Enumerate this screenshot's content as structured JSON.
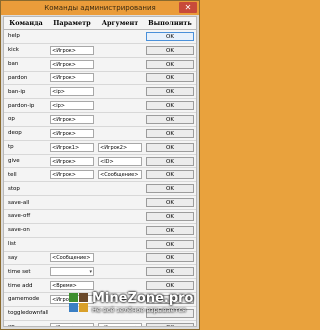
{
  "window": {
    "title": "Команды администрирования",
    "close_glyph": "✕"
  },
  "headers": [
    "Команда",
    "Параметр",
    "Аргумент",
    "Выполнить"
  ],
  "rows": [
    {
      "cmd": "help",
      "param": null,
      "arg": null,
      "ok": "OK",
      "primary": true
    },
    {
      "cmd": "kick",
      "param": {
        "type": "text",
        "value": "<Игрок>"
      },
      "arg": null,
      "ok": "OK"
    },
    {
      "cmd": "ban",
      "param": {
        "type": "text",
        "value": "<Игрок>"
      },
      "arg": null,
      "ok": "OK"
    },
    {
      "cmd": "pardon",
      "param": {
        "type": "text",
        "value": "<Игрок>"
      },
      "arg": null,
      "ok": "OK"
    },
    {
      "cmd": "ban-ip",
      "param": {
        "type": "text",
        "value": "<ip>"
      },
      "arg": null,
      "ok": "OK"
    },
    {
      "cmd": "pardon-ip",
      "param": {
        "type": "text",
        "value": "<ip>"
      },
      "arg": null,
      "ok": "OK"
    },
    {
      "cmd": "op",
      "param": {
        "type": "text",
        "value": "<Игрок>"
      },
      "arg": null,
      "ok": "OK"
    },
    {
      "cmd": "deop",
      "param": {
        "type": "text",
        "value": "<Игрок>"
      },
      "arg": null,
      "ok": "OK"
    },
    {
      "cmd": "tp",
      "param": {
        "type": "text",
        "value": "<Игрок1>"
      },
      "arg": {
        "type": "text",
        "value": "<Игрок2>"
      },
      "ok": "OK"
    },
    {
      "cmd": "give",
      "param": {
        "type": "text",
        "value": "<Игрок>"
      },
      "arg": {
        "type": "text",
        "value": "<ID>"
      },
      "ok": "OK"
    },
    {
      "cmd": "tell",
      "param": {
        "type": "text",
        "value": "<Игрок>"
      },
      "arg": {
        "type": "text",
        "value": "<Сообщение>"
      },
      "ok": "OK"
    },
    {
      "cmd": "stop",
      "param": null,
      "arg": null,
      "ok": "OK"
    },
    {
      "cmd": "save-all",
      "param": null,
      "arg": null,
      "ok": "OK"
    },
    {
      "cmd": "save-off",
      "param": null,
      "arg": null,
      "ok": "OK"
    },
    {
      "cmd": "save-on",
      "param": null,
      "arg": null,
      "ok": "OK"
    },
    {
      "cmd": "list",
      "param": null,
      "arg": null,
      "ok": "OK"
    },
    {
      "cmd": "say",
      "param": {
        "type": "text",
        "value": "<Сообщение>"
      },
      "arg": null,
      "ok": "OK"
    },
    {
      "cmd": "time set",
      "param": {
        "type": "select",
        "value": ""
      },
      "arg": null,
      "ok": "OK"
    },
    {
      "cmd": "time add",
      "param": {
        "type": "text",
        "value": "<Время>"
      },
      "arg": null,
      "ok": "OK"
    },
    {
      "cmd": "gamemode",
      "param": {
        "type": "text",
        "value": "<Игрок>"
      },
      "arg": null,
      "ok": ""
    },
    {
      "cmd": "toggledownfall",
      "param": null,
      "arg": null,
      "ok": ""
    },
    {
      "cmd": "xp",
      "param": {
        "type": "text",
        "value": "<Игрок>"
      },
      "arg": {
        "type": "text",
        "value": "<Количество>"
      },
      "ok": "OK"
    }
  ],
  "watermark": {
    "brand": "MineZone.pro",
    "tagline": "Не всё зелёное взрывается",
    "logo_colors": [
      "#3e8e2e",
      "#6b4a2b",
      "#3a7fc4",
      "#d9a02a"
    ]
  }
}
